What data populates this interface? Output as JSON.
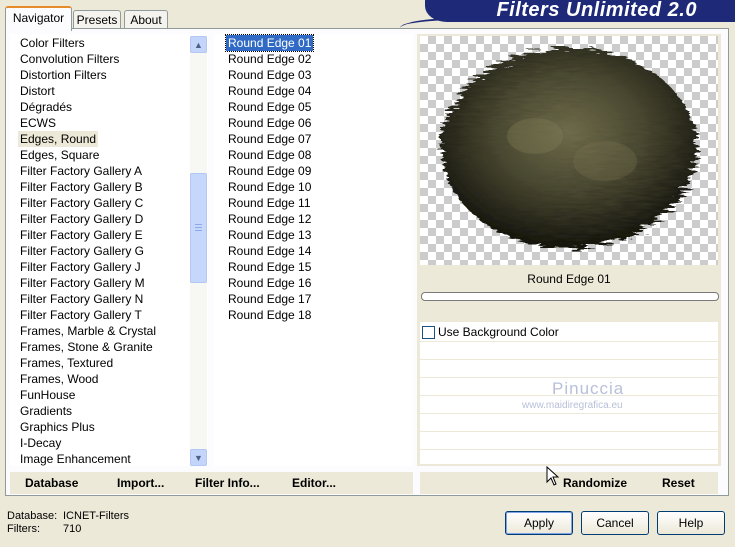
{
  "tabs": [
    {
      "label": "Navigator",
      "active": true
    },
    {
      "label": "Presets",
      "active": false
    },
    {
      "label": "About",
      "active": false
    }
  ],
  "banner": {
    "title": "Filters Unlimited 2.0"
  },
  "categories": [
    {
      "label": "Color Filters"
    },
    {
      "label": "Convolution Filters"
    },
    {
      "label": "Distortion Filters"
    },
    {
      "label": "Distort"
    },
    {
      "label": "Dégradés"
    },
    {
      "label": "ECWS"
    },
    {
      "label": "Edges, Round",
      "selected": true
    },
    {
      "label": "Edges, Square"
    },
    {
      "label": "Filter Factory Gallery A"
    },
    {
      "label": "Filter Factory Gallery B"
    },
    {
      "label": "Filter Factory Gallery C"
    },
    {
      "label": "Filter Factory Gallery D"
    },
    {
      "label": "Filter Factory Gallery E"
    },
    {
      "label": "Filter Factory Gallery G"
    },
    {
      "label": "Filter Factory Gallery J"
    },
    {
      "label": "Filter Factory Gallery M"
    },
    {
      "label": "Filter Factory Gallery N"
    },
    {
      "label": "Filter Factory Gallery T"
    },
    {
      "label": "Frames, Marble & Crystal"
    },
    {
      "label": "Frames, Stone & Granite"
    },
    {
      "label": "Frames, Textured"
    },
    {
      "label": "Frames, Wood"
    },
    {
      "label": "FunHouse"
    },
    {
      "label": "Gradients"
    },
    {
      "label": "Graphics Plus"
    },
    {
      "label": "I-Decay"
    },
    {
      "label": "Image Enhancement"
    }
  ],
  "filters": [
    {
      "label": "Round Edge 01",
      "selected": true
    },
    {
      "label": "Round Edge 02"
    },
    {
      "label": "Round Edge 03"
    },
    {
      "label": "Round Edge 04"
    },
    {
      "label": "Round Edge 05"
    },
    {
      "label": "Round Edge 06"
    },
    {
      "label": "Round Edge 07"
    },
    {
      "label": "Round Edge 08"
    },
    {
      "label": "Round Edge 09"
    },
    {
      "label": "Round Edge 10"
    },
    {
      "label": "Round Edge 11"
    },
    {
      "label": "Round Edge 12"
    },
    {
      "label": "Round Edge 13"
    },
    {
      "label": "Round Edge 14"
    },
    {
      "label": "Round Edge 15"
    },
    {
      "label": "Round Edge 16"
    },
    {
      "label": "Round Edge 17"
    },
    {
      "label": "Round Edge 18"
    }
  ],
  "left_toolbar": {
    "database": "Database",
    "import": "Import...",
    "filter_info": "Filter Info...",
    "editor": "Editor..."
  },
  "preview": {
    "caption": "Round Edge 01",
    "progress": 0
  },
  "options": {
    "use_background_color": "Use Background Color",
    "use_background_checked": false
  },
  "watermark": {
    "name": "Pinuccia",
    "url": "www.maidiregrafica.eu"
  },
  "right_toolbar": {
    "randomize": "Randomize",
    "reset": "Reset"
  },
  "status": {
    "database_label": "Database:",
    "database_value": "ICNET-Filters",
    "filters_label": "Filters:",
    "filters_value": "710"
  },
  "buttons": {
    "apply": "Apply",
    "cancel": "Cancel",
    "help": "Help"
  },
  "colors": {
    "selection": "#316ac5",
    "banner": "#1e2a78",
    "window_bg": "#ece9d8"
  }
}
